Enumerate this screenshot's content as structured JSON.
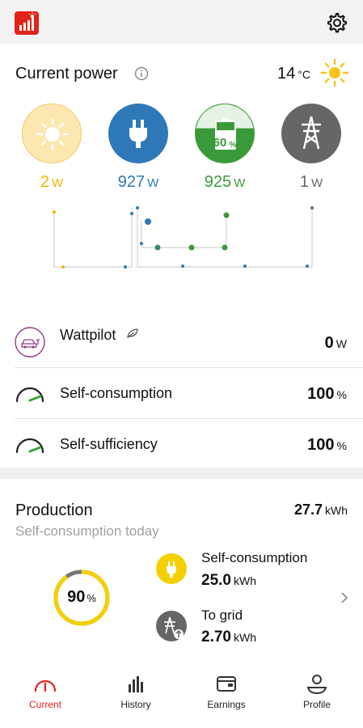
{
  "header": {
    "logo_icon": "solar-logo-icon",
    "settings_icon": "gear-icon"
  },
  "current_power": {
    "title": "Current power",
    "temperature_value": "14",
    "temperature_unit": "°C",
    "weather_icon": "sun-icon",
    "sources": [
      {
        "name": "pv",
        "icon": "sun-icon",
        "value": "2",
        "unit": "W",
        "color": "#f0b400"
      },
      {
        "name": "consumption",
        "icon": "plug-icon",
        "value": "927",
        "unit": "W",
        "color": "#2f78b8"
      },
      {
        "name": "battery",
        "icon": "battery-icon",
        "value": "925",
        "unit": "W",
        "color": "#3a9a3a",
        "battery_label": "60",
        "battery_unit": "%",
        "battery_level": 0.6
      },
      {
        "name": "grid",
        "icon": "power-tower-icon",
        "value": "1",
        "unit": "W",
        "color": "#666666"
      }
    ]
  },
  "stats": [
    {
      "label": "Wattpilot",
      "value": "0",
      "unit": "W",
      "icon": "ev-charger-icon",
      "badge_icon": "leaf-icon"
    },
    {
      "label": "Self-consumption",
      "value": "100",
      "unit": "%",
      "icon": "gauge-icon"
    },
    {
      "label": "Self-sufficiency",
      "value": "100",
      "unit": "%",
      "icon": "gauge-icon"
    }
  ],
  "production": {
    "title": "Production",
    "total_value": "27.7",
    "total_unit": "kWh",
    "subtitle": "Self-consumption today",
    "ring_value": "90",
    "ring_unit": "%",
    "ring_fraction": 0.9,
    "items": [
      {
        "label": "Self-consumption",
        "value": "25.0",
        "unit": "kWh",
        "icon": "plug-icon",
        "color": "#f5d000"
      },
      {
        "label": "To grid",
        "value": "2.70",
        "unit": "kWh",
        "icon": "power-tower-upload-icon",
        "color": "#666666"
      }
    ]
  },
  "tabs": [
    {
      "label": "Current",
      "icon": "gauge-icon",
      "active": true
    },
    {
      "label": "History",
      "icon": "bar-chart-icon",
      "active": false
    },
    {
      "label": "Earnings",
      "icon": "wallet-icon",
      "active": false
    },
    {
      "label": "Profile",
      "icon": "user-icon",
      "active": false
    }
  ]
}
